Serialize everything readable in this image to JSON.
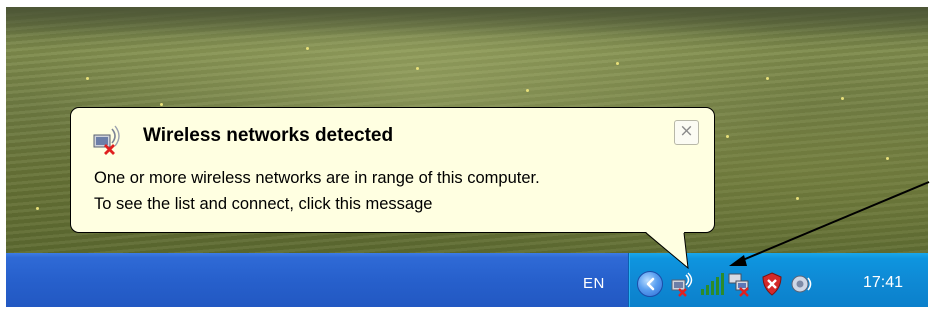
{
  "balloon": {
    "title": "Wireless networks detected",
    "line1": "One or more wireless networks are in range of this computer.",
    "line2": "To see the list and connect, click this message",
    "close_symbol": "×",
    "icon": "wireless-network-disconnected-icon"
  },
  "taskbar": {
    "language": "EN",
    "clock": "17:41",
    "tray_icons": [
      "show-hidden-icons-chevron",
      "wireless-network-disconnected-icon",
      "signal-strength-icon",
      "network-disconnected-icon",
      "security-shield-icon",
      "volume-icon"
    ]
  },
  "colors": {
    "taskbar_blue": "#2760cc",
    "tray_blue": "#0f8ad5",
    "balloon_background": "#ffffe1",
    "error_red": "#d22"
  }
}
